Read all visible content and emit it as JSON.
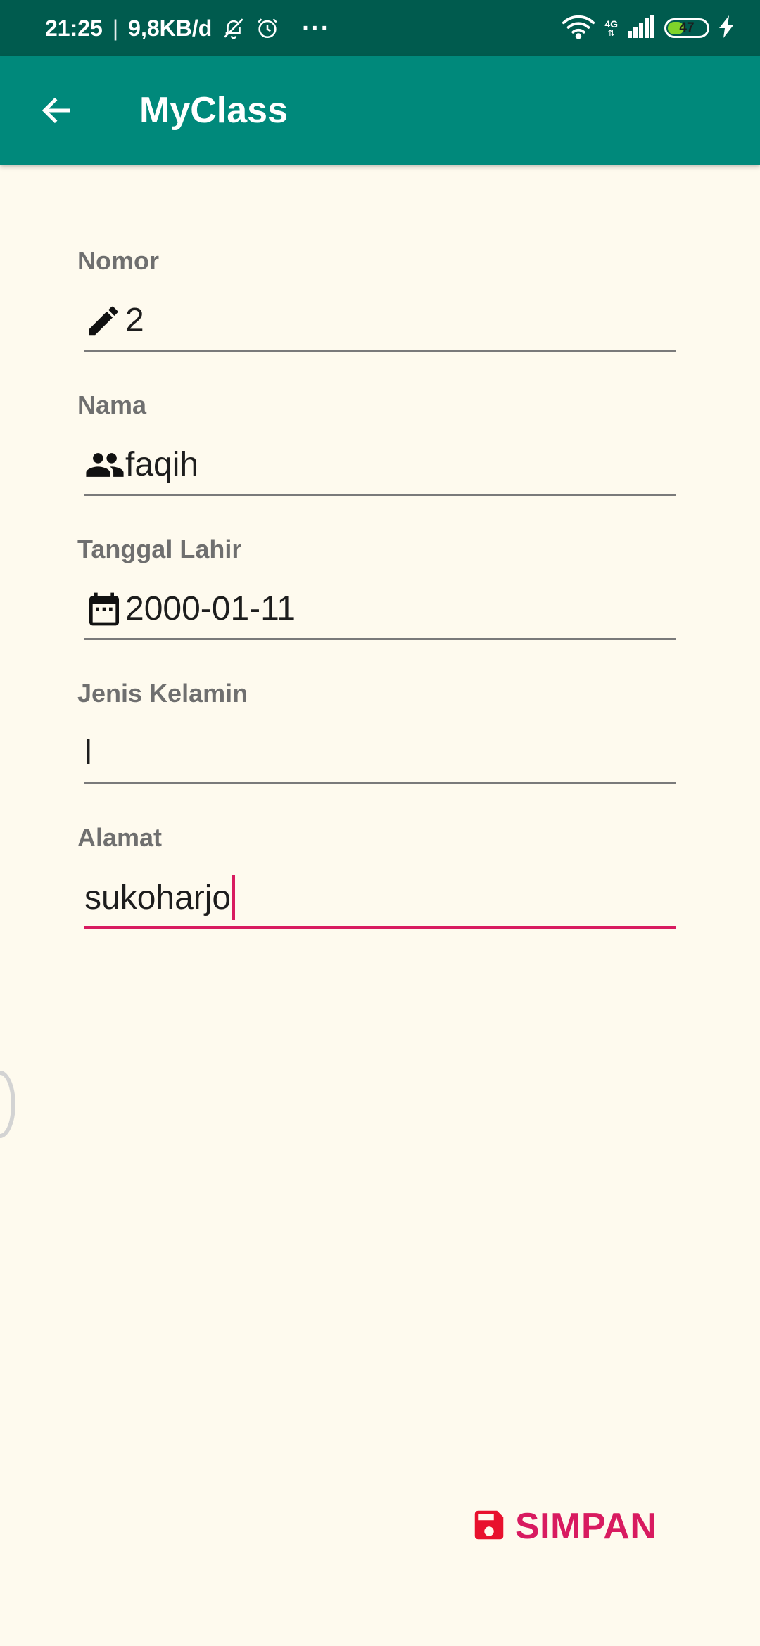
{
  "status_bar": {
    "time": "21:25",
    "separator": "|",
    "network_speed": "9,8KB/d",
    "more": "···",
    "network_type": "4G",
    "battery_level": "47"
  },
  "app_bar": {
    "title": "MyClass"
  },
  "form": {
    "fields": [
      {
        "label": "Nomor",
        "value": "2",
        "icon": "pencil-icon"
      },
      {
        "label": "Nama",
        "value": "faqih",
        "icon": "people-icon"
      },
      {
        "label": "Tanggal Lahir",
        "value": "2000-01-11",
        "icon": "calendar-icon"
      },
      {
        "label": "Jenis Kelamin",
        "value": "l"
      },
      {
        "label": "Alamat",
        "value": "sukoharjo"
      }
    ]
  },
  "save_button": {
    "label": "SIMPAN",
    "icon": "floppy-disk-icon"
  },
  "colors": {
    "status_bar": "#005B4E",
    "app_bar": "#00897B",
    "background": "#FEFAEE",
    "accent": "#D81B60",
    "save_icon": "#E8112D"
  }
}
